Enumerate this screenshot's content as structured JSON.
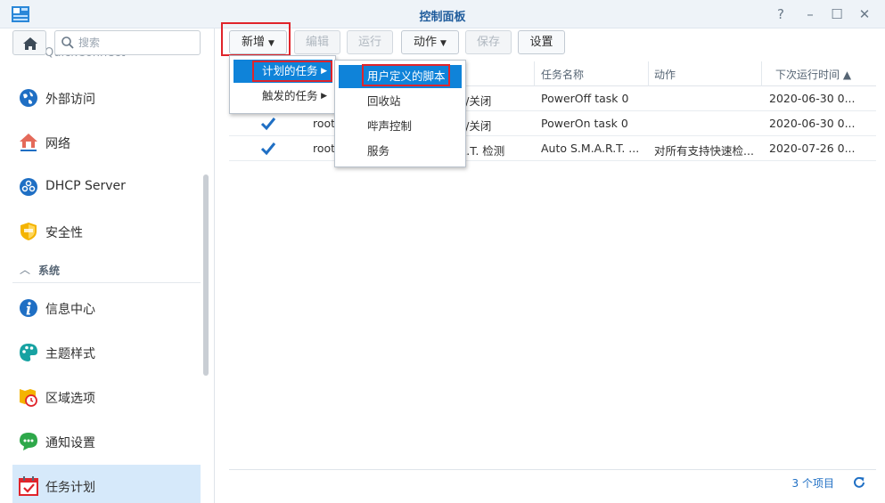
{
  "window": {
    "title": "控制面板",
    "controls": [
      "?",
      "–",
      "☐",
      "✕"
    ]
  },
  "sidebar": {
    "search_placeholder": "搜索",
    "partial_item": "QuickConnect",
    "items": [
      {
        "label": "外部访问",
        "icon": "globe-icon"
      },
      {
        "label": "网络",
        "icon": "network-house-icon"
      },
      {
        "label": "DHCP Server",
        "icon": "dhcp-icon"
      },
      {
        "label": "安全性",
        "icon": "shield-icon"
      }
    ],
    "section": "系统",
    "system_items": [
      {
        "label": "信息中心",
        "icon": "info-icon"
      },
      {
        "label": "主题样式",
        "icon": "palette-icon"
      },
      {
        "label": "区域选项",
        "icon": "region-clock-icon"
      },
      {
        "label": "通知设置",
        "icon": "chat-bubble-icon"
      },
      {
        "label": "任务计划",
        "icon": "calendar-check-icon",
        "selected": true
      }
    ]
  },
  "toolbar": {
    "create": "新增",
    "edit": "编辑",
    "run": "运行",
    "action": "动作",
    "save": "保存",
    "settings": "设置"
  },
  "table": {
    "headers": [
      "任务名称",
      "动作",
      "下次运行时间 ▲"
    ],
    "rows": [
      {
        "user": "",
        "type": "F/关闭",
        "name": "PowerOff task 0",
        "action": "",
        "next": "2020-06-30 0..."
      },
      {
        "user": "root",
        "type": "F/关闭",
        "name": "PowerOn task 0",
        "action": "",
        "next": "2020-06-30 0..."
      },
      {
        "user": "root",
        "type": "R.T. 检测",
        "name": "Auto S.M.A.R.T. ...",
        "action": "对所有支持快速检...",
        "next": "2020-07-26 0..."
      }
    ],
    "footer_count": "3 个项目"
  },
  "menus": {
    "create_menu": [
      "计划的任务",
      "触发的任务"
    ],
    "scheduled_submenu": [
      "用户定义的脚本",
      "回收站",
      "哔声控制",
      "服务"
    ]
  },
  "colors": {
    "accent": "#0f83d9",
    "highlight": "#e0242b",
    "selected_bg": "#d6e9fa",
    "title": "#1f5c9c"
  }
}
